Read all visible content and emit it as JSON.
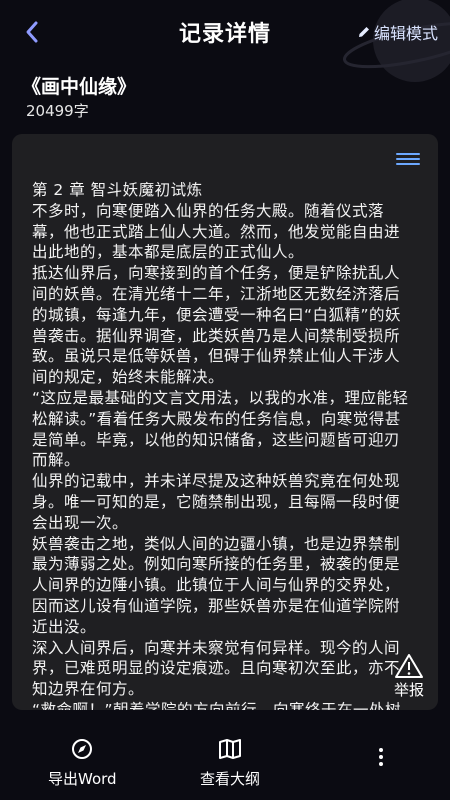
{
  "header": {
    "title": "记录详情",
    "edit_label": "编辑模式",
    "back_icon": "back-arrow-icon",
    "edit_icon": "pencil-icon",
    "accent": "#6ca8ff"
  },
  "book": {
    "title": "《画中仙缘》",
    "word_count": "20499字"
  },
  "content": {
    "paragraphs": [
      "第 2 章 智斗妖魔初试炼",
      "不多时，向寒便踏入仙界的任务大殿。随着仪式落幕，他也正式踏上仙人大道。然而，他发觉能自由进出此地的，基本都是底层的正式仙人。",
      "抵达仙界后，向寒接到的首个任务，便是铲除扰乱人间的妖兽。在清光绪十二年，江浙地区无数经济落后的城镇，每逢九年，便会遭受一种名曰“白狐精”的妖兽袭击。据仙界调查，此类妖兽乃是人间禁制受损所致。虽说只是低等妖兽，但碍于仙界禁止仙人干涉人间的规定，始终未能解决。",
      "“这应是最基础的文言文用法，以我的水准，理应能轻松解读。”看着任务大殿发布的任务信息，向寒觉得甚是简单。毕竟，以他的知识储备，这些问题皆可迎刃而解。",
      "仙界的记载中，并未详尽提及这种妖兽究竟在何处现身。唯一可知的是，它随禁制出现，且每隔一段时便会出现一次。",
      "妖兽袭击之地，类似人间的边疆小镇，也是边界禁制最为薄弱之处。例如向寒所接的任务里，被袭的便是人间界的边陲小镇。此镇位于人间与仙界的交界处，因而这儿设有仙道学院，那些妖兽亦是在仙道学院附近出没。",
      "深入人间界后，向寒并未察觉有何异样。现今的人间界，已难觅明显的设定痕迹。且向寒初次至此，亦不知边界在何方。",
      "“救命啊！”朝着学院的方向前行，向寒终于在一处树林中听闻呼救声。听觉与嗅觉皆变得极其敏锐的他，很快便在林中看到五彩斑斓的烟雾。并"
    ],
    "menu_icon": "hamburger-menu-icon"
  },
  "report": {
    "label": "举报",
    "icon": "warning-triangle-icon"
  },
  "bottom_bar": {
    "export_label": "导出Word",
    "export_icon": "compass-icon",
    "outline_label": "查看大纲",
    "outline_icon": "open-book-icon",
    "more_icon": "more-vertical-icon"
  }
}
